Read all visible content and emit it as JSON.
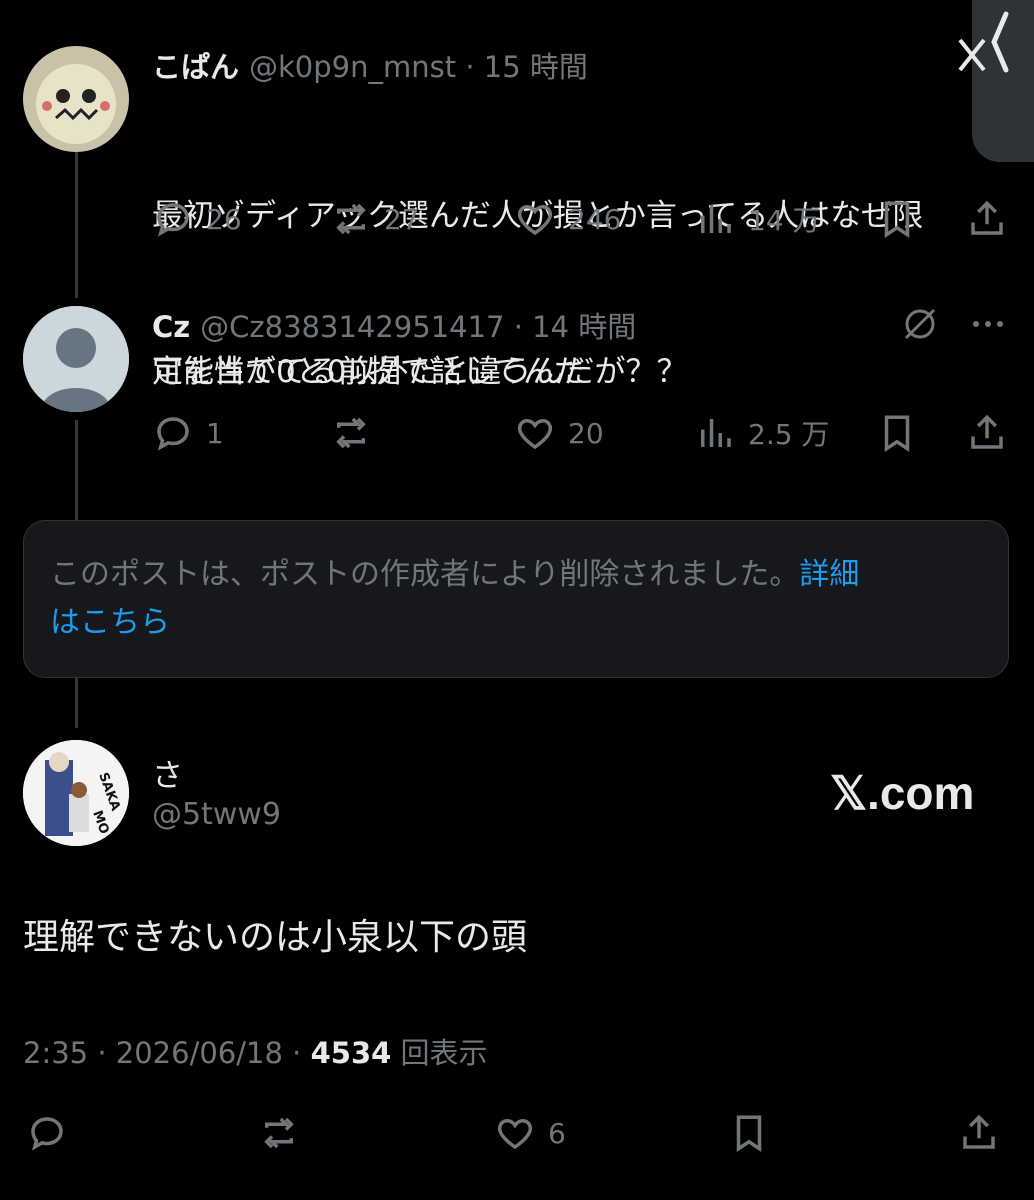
{
  "post1": {
    "name": "こぱん",
    "handle": "@k0p9n_mnst",
    "time": "15 時間",
    "text_line1": "最初ゾディアック選んだ人が損とか言ってる人はなぜ限",
    "text_line2": "定を当ててる前提で話してんだ",
    "replies": "26",
    "reposts": "27",
    "likes": "246",
    "views": "14 万"
  },
  "post2": {
    "name": "Cz",
    "handle": "@Cz8383142951417",
    "time": "14 時間",
    "text": "可能性が0と0以外だと違うんだが？？",
    "replies": "1",
    "likes": "20",
    "views": "2.5 万"
  },
  "deleted": {
    "text": "このポストは、ポストの作成者により削除されました。",
    "link_line1": "詳細",
    "link_line2": "はこちら"
  },
  "main": {
    "name": "さ",
    "handle": "@5tww9",
    "badge": "𝕏.com",
    "text": "理解できないのは小泉以下の頭",
    "time": "2:35",
    "date": "2026/06/18",
    "views_count": "4534",
    "views_label": "回表示",
    "likes": "6"
  },
  "colors": {
    "background": "#000000",
    "muted": "#71767b",
    "link": "#1d9bf0"
  }
}
